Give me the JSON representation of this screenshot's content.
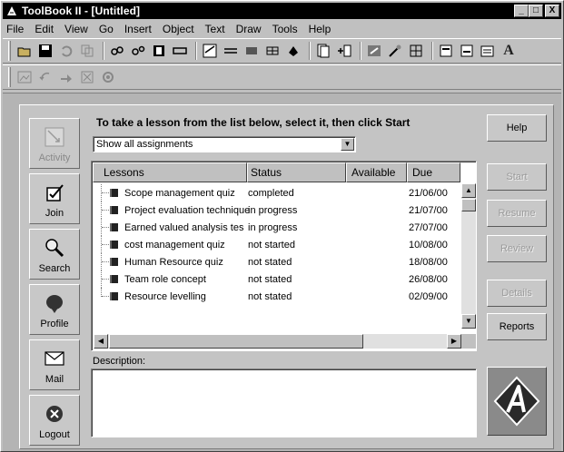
{
  "window": {
    "title": "ToolBook II - [Untitled]",
    "controls": [
      "_",
      "□",
      "X"
    ]
  },
  "menu": [
    {
      "label": "File"
    },
    {
      "label": "Edit"
    },
    {
      "label": "View"
    },
    {
      "label": "Go"
    },
    {
      "label": "Insert"
    },
    {
      "label": "Object"
    },
    {
      "label": "Text"
    },
    {
      "label": "Draw"
    },
    {
      "label": "Tools"
    },
    {
      "label": "Help"
    }
  ],
  "toolbar1_icons": [
    "open-icon",
    "save-icon",
    "undo-icon",
    "copy-icon",
    "link-icon",
    "unlink-icon",
    "record-icon",
    "field-icon",
    "checkbox-draw-icon",
    "line-icon",
    "fill-icon",
    "pattern-icon",
    "paint-icon",
    "page-icon",
    "add-page-icon",
    "catalog-icon",
    "wizard-icon",
    "grid-icon",
    "properties-icon",
    "book-properties-icon",
    "text-properties-icon",
    "font-icon"
  ],
  "toolbar2_icons": [
    "image-icon",
    "back-icon",
    "forward-icon",
    "stop-icon",
    "settings-icon"
  ],
  "nav": [
    {
      "label": "Activity",
      "disabled": true
    },
    {
      "label": "Join",
      "disabled": false
    },
    {
      "label": "Search",
      "disabled": false
    },
    {
      "label": "Profile",
      "disabled": false
    },
    {
      "label": "Mail",
      "disabled": false
    },
    {
      "label": "Logout",
      "disabled": false
    }
  ],
  "instruction": "To take a lesson from the list below, select it, then click Start",
  "filter": {
    "selected": "Show all assignments"
  },
  "list": {
    "columns": [
      "Lessons",
      "Status",
      "Available",
      "Due"
    ],
    "rows": [
      {
        "lesson": "Scope management quiz",
        "status": "completed",
        "available": "",
        "due": "21/06/00"
      },
      {
        "lesson": "Project evaluation technique",
        "status": "in progress",
        "available": "",
        "due": "21/07/00"
      },
      {
        "lesson": "Earned valued analysis tes",
        "status": "in progress",
        "available": "",
        "due": "27/07/00"
      },
      {
        "lesson": "cost management quiz",
        "status": "not started",
        "available": "",
        "due": "10/08/00"
      },
      {
        "lesson": "Human Resource quiz",
        "status": "not stated",
        "available": "",
        "due": "18/08/00"
      },
      {
        "lesson": "Team role concept",
        "status": "not stated",
        "available": "",
        "due": "26/08/00"
      },
      {
        "lesson": "Resource levelling",
        "status": "not stated",
        "available": "",
        "due": "02/09/00"
      }
    ]
  },
  "description": {
    "label": "Description:",
    "text": ""
  },
  "buttons": {
    "help": "Help",
    "start": "Start",
    "resume": "Resume",
    "review": "Review",
    "details": "Details",
    "reports": "Reports"
  }
}
